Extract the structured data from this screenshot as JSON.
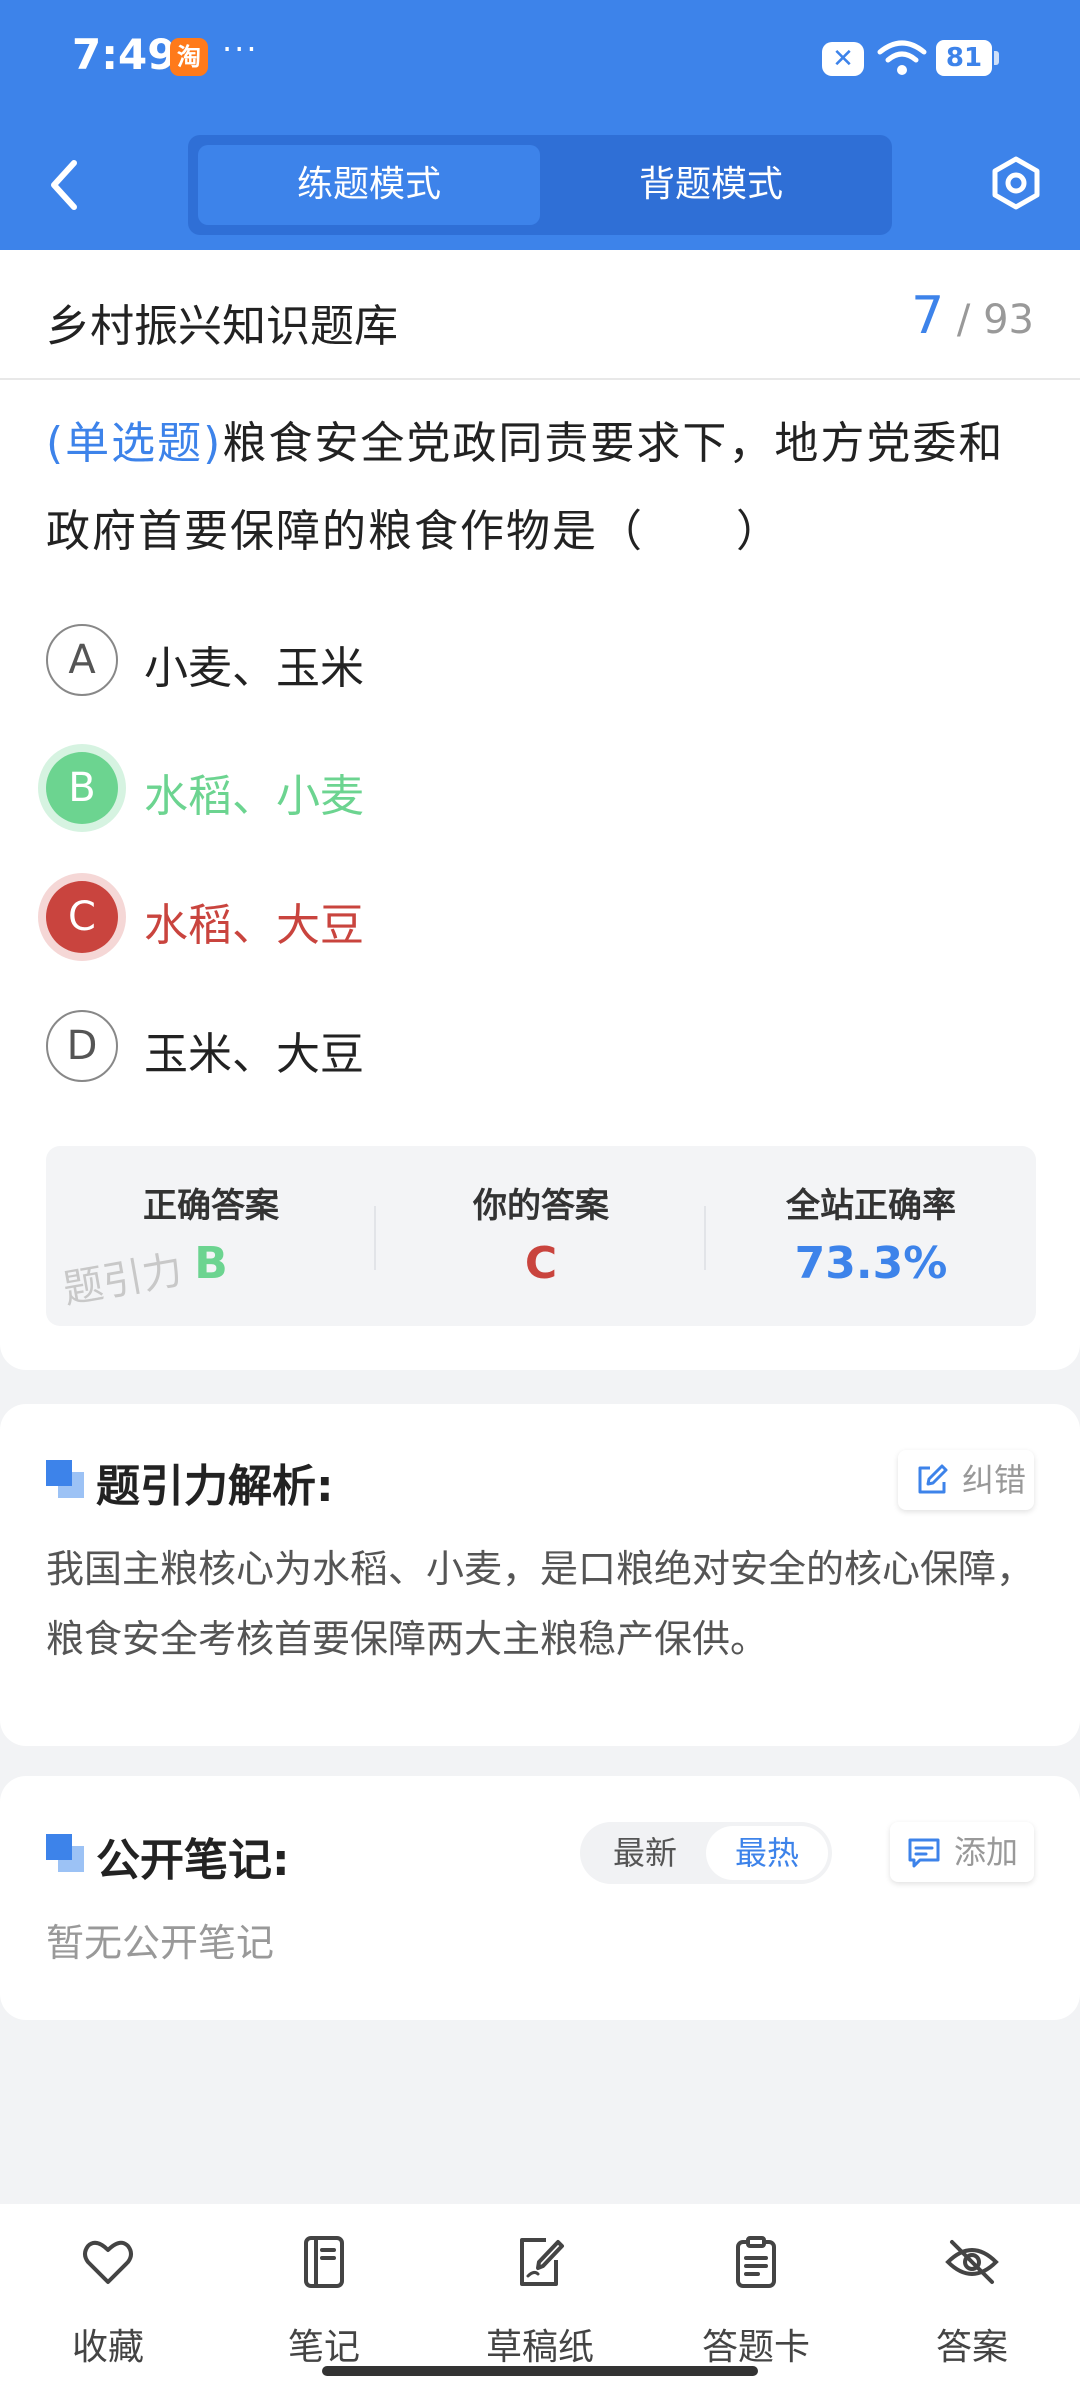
{
  "status_bar": {
    "time": "7:49",
    "app_icon": "淘",
    "more": "···",
    "battery": "81"
  },
  "header": {
    "modes": [
      "练题模式",
      "背题模式"
    ],
    "active_mode": "练题模式",
    "colors": {
      "primary": "#3d83ea"
    }
  },
  "question_card": {
    "bank_title": "乡村振兴知识题库",
    "current": "7",
    "separator": "/",
    "total": "93",
    "question_type": "(单选题)",
    "question_text": "粮食安全党政同责要求下，地方党委和政府首要保障的粮食作物是（　　）",
    "options": [
      {
        "letter": "A",
        "text": "小麦、玉米",
        "state": "normal"
      },
      {
        "letter": "B",
        "text": "水稻、小麦",
        "state": "correct"
      },
      {
        "letter": "C",
        "text": "水稻、大豆",
        "state": "wrong"
      },
      {
        "letter": "D",
        "text": "玉米、大豆",
        "state": "normal"
      }
    ],
    "result": {
      "correct_label": "正确答案",
      "correct_value": "B",
      "yours_label": "你的答案",
      "yours_value": "C",
      "rate_label": "全站正确率",
      "rate_value": "73.3%",
      "watermark": "题引力"
    },
    "colors": {
      "correct": "#6cd490",
      "wrong": "#c9443e"
    }
  },
  "analysis": {
    "title": "题引力解析:",
    "report_button": "纠错",
    "text": "我国主粮核心为水稻、小麦，是口粮绝对安全的核心保障，粮食安全考核首要保障两大主粮稳产保供。"
  },
  "notes": {
    "title": "公开笔记:",
    "sort_tabs": [
      "最新",
      "最热"
    ],
    "active_sort": "最热",
    "add_button": "添加",
    "empty_text": "暂无公开笔记"
  },
  "bottom_bar": {
    "items": [
      {
        "label": "收藏",
        "icon": "heart-icon"
      },
      {
        "label": "笔记",
        "icon": "notebook-icon"
      },
      {
        "label": "草稿纸",
        "icon": "draft-icon"
      },
      {
        "label": "答题卡",
        "icon": "answer-card-icon"
      },
      {
        "label": "答案",
        "icon": "eye-off-icon"
      }
    ]
  }
}
